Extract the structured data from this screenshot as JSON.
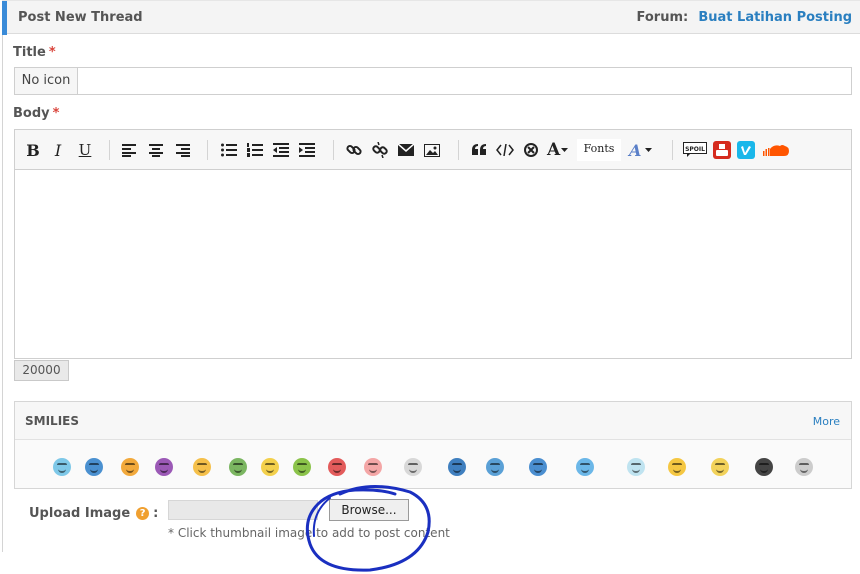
{
  "header": {
    "title": "Post New Thread",
    "forum_label": "Forum:",
    "forum_name": "Buat Latihan Posting"
  },
  "title_field": {
    "label": "Title",
    "required_mark": "*",
    "icon_select": "No icon",
    "value": "",
    "placeholder": ""
  },
  "body_field": {
    "label": "Body",
    "required_mark": "*",
    "value": "",
    "char_counter": "20000"
  },
  "toolbar": {
    "bold": "B",
    "italic": "I",
    "underline": "U",
    "fonts": "Fonts",
    "font_size_letter": "A",
    "font_color_letter": "A",
    "spoil_label": "SPOIL",
    "icons": [
      "bold",
      "italic",
      "underline",
      "align-left-icon",
      "align-center-icon",
      "align-right-icon",
      "bullet-list-icon",
      "numbered-list-icon",
      "outdent-icon",
      "indent-icon",
      "link-icon",
      "unlink-icon",
      "email-icon",
      "image-icon",
      "quote-icon",
      "code-icon",
      "strikethrough-circle-icon",
      "font-size-icon",
      "fonts-select",
      "font-color-icon",
      "spoiler-icon",
      "youtube-icon",
      "vimeo-icon",
      "soundcloud-icon"
    ]
  },
  "smilies": {
    "title": "SMILIES",
    "more_link": "More",
    "items": [
      {
        "name": "smiley-1",
        "color": "#7ec8e8"
      },
      {
        "name": "smiley-2",
        "color": "#4a90d0"
      },
      {
        "name": "smiley-3",
        "color": "#f2a93b"
      },
      {
        "name": "smiley-4",
        "color": "#9b59b6"
      },
      {
        "name": "smiley-5",
        "color": "#f5c04a"
      },
      {
        "name": "smiley-6",
        "color": "#7bb661"
      },
      {
        "name": "smiley-7",
        "color": "#f3d04b"
      },
      {
        "name": "smiley-8",
        "color": "#8bc34a"
      },
      {
        "name": "smiley-9",
        "color": "#e35b5b"
      },
      {
        "name": "smiley-10",
        "color": "#f4a6a6"
      },
      {
        "name": "smiley-11",
        "color": "#d8d8d8"
      },
      {
        "name": "smiley-12",
        "color": "#3f7fbf"
      },
      {
        "name": "smiley-13",
        "color": "#5aa0d6"
      },
      {
        "name": "smiley-14",
        "color": "#4a8ed0"
      },
      {
        "name": "smiley-15",
        "color": "#6bb7e8"
      },
      {
        "name": "smiley-16",
        "color": "#bfe3f0"
      },
      {
        "name": "smiley-17",
        "color": "#f5c742"
      },
      {
        "name": "smiley-18",
        "color": "#f2d25a"
      },
      {
        "name": "smiley-19",
        "color": "#444444"
      },
      {
        "name": "smiley-20",
        "color": "#cccccc"
      }
    ]
  },
  "upload": {
    "label": "Upload Image",
    "help_glyph": "?",
    "colon": ":",
    "browse_label": "Browse...",
    "note": "* Click thumbnail image to add to post content"
  },
  "colors": {
    "accent_bar": "#3a8bd8",
    "link": "#2a7fc0",
    "required": "#d9443b",
    "help": "#f0a030",
    "annotation_scribble": "#1a2fc0"
  }
}
